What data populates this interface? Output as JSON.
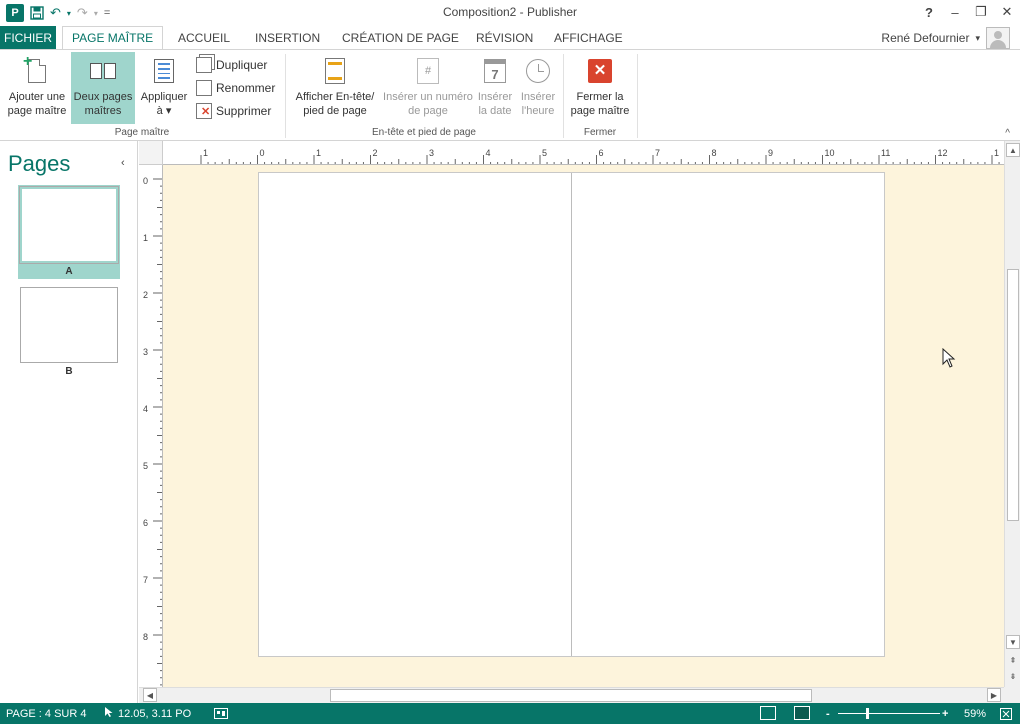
{
  "window": {
    "title": "Composition2 - Publisher",
    "app_icon_label": "P",
    "controls": {
      "help": "?",
      "minimize": "–",
      "restore": "❐",
      "close": "✕"
    }
  },
  "qat": {
    "save": "💾",
    "undo": "↶",
    "redo": "↷",
    "customize": "="
  },
  "tabs": [
    {
      "label": "FICHIER"
    },
    {
      "label": "PAGE MAÎTRE"
    },
    {
      "label": "ACCUEIL"
    },
    {
      "label": "INSERTION"
    },
    {
      "label": "CRÉATION DE PAGE"
    },
    {
      "label": "RÉVISION"
    },
    {
      "label": "AFFICHAGE"
    }
  ],
  "user": {
    "name": "René Defournier",
    "caret": "▾"
  },
  "ribbon": {
    "add_master": "Ajouter une page maître",
    "two_pages": "Deux pages maîtres",
    "apply_to": "Appliquer à ▾",
    "duplicate": "Dupliquer",
    "rename": "Renommer",
    "delete": "Supprimer",
    "group_master": "Page maître",
    "show_header": "Afficher En-tête/ pied de page",
    "insert_page_number": "Insérer un numéro de page",
    "insert_date": "Insérer la date",
    "insert_time": "Insérer l'heure",
    "group_header": "En-tête et pied de page",
    "close_master": "Fermer la page maître",
    "group_close": "Fermer",
    "calendar_digit": "7",
    "page_number_glyph": "#",
    "collapse": "^"
  },
  "pages_pane": {
    "title": "Pages",
    "collapse": "‹",
    "thumbs": [
      {
        "label": "A"
      },
      {
        "label": "B"
      }
    ]
  },
  "ruler": {
    "h_labels": [
      "1",
      "0",
      "1",
      "2",
      "3",
      "4",
      "5",
      "6",
      "7",
      "8",
      "9",
      "10",
      "11",
      "12",
      "1"
    ],
    "v_labels": [
      "0",
      "1",
      "2",
      "3",
      "4",
      "5",
      "6",
      "7",
      "8"
    ]
  },
  "status": {
    "page": "PAGE : 4 SUR 4",
    "position": "12.05, 3.11 PO",
    "zoom": "59%",
    "zoom_minus": "-",
    "zoom_plus": "+"
  },
  "colors": {
    "accent": "#077568",
    "canvas": "#fdf4dc",
    "selected": "#9fd5cc",
    "close_red": "#d9442e"
  }
}
